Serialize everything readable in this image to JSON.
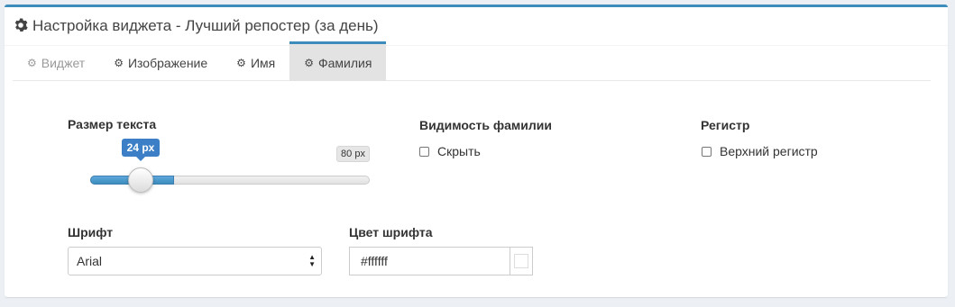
{
  "header": {
    "title": "Настройка виджета - Лучший репостер (за день)",
    "icon": "gear-icon"
  },
  "tabs": [
    {
      "label": "Виджет",
      "state": "muted"
    },
    {
      "label": "Изображение",
      "state": "normal"
    },
    {
      "label": "Имя",
      "state": "normal"
    },
    {
      "label": "Фамилия",
      "state": "active"
    }
  ],
  "text_size": {
    "label": "Размер текста",
    "value_label": "24 px",
    "max_label": "80 px",
    "value": 24,
    "max": 80
  },
  "surname_visibility": {
    "label": "Видимость фамилии",
    "option": "Скрыть",
    "checked": false
  },
  "register": {
    "label": "Регистр",
    "option": "Верхний регистр",
    "checked": false
  },
  "font": {
    "label": "Шрифт",
    "selected": "Arial"
  },
  "font_color": {
    "label": "Цвет шрифта",
    "value": "#ffffff",
    "swatch": "#ffffff"
  },
  "colors": {
    "accent": "#3c8dbc",
    "background": "#ecf0f5",
    "active_tab": "#e3e3e3"
  }
}
